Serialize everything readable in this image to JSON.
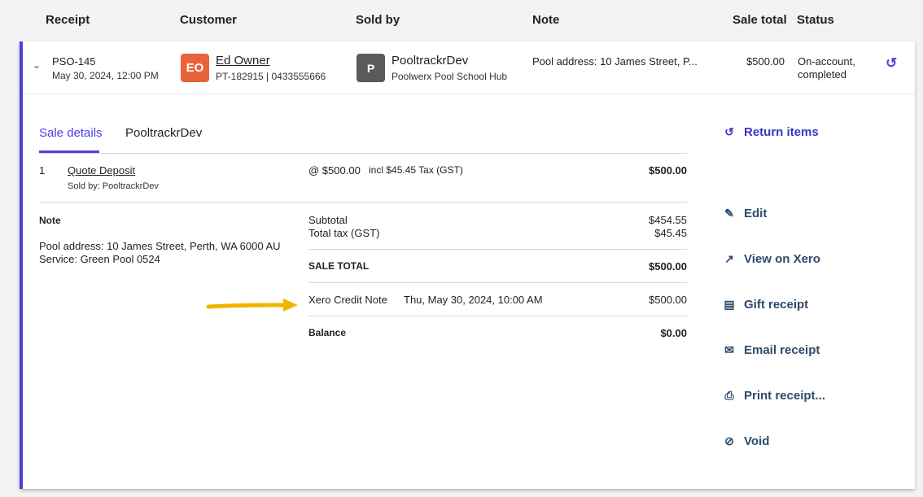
{
  "header": {
    "receipt": "Receipt",
    "customer": "Customer",
    "sold_by": "Sold by",
    "note": "Note",
    "sale_total": "Sale total",
    "status": "Status"
  },
  "row": {
    "receipt_id": "PSO-145",
    "receipt_date": "May 30, 2024, 12:00 PM",
    "customer_initials": "EO",
    "customer_name": "Ed Owner",
    "customer_sub": "PT-182915 | 0433555666",
    "sold_initial": "P",
    "sold_name": "PooltrackrDev",
    "sold_sub": "Poolwerx Pool School Hub",
    "note": "Pool address: 10 James Street, P...",
    "total": "$500.00",
    "status_line1": "On-account,",
    "status_line2": "completed"
  },
  "tabs": [
    {
      "label": "Sale details"
    },
    {
      "label": "PooltrackrDev"
    }
  ],
  "line_item": {
    "qty": "1",
    "name": "Quote Deposit",
    "sold_by": "Sold by: PooltrackrDev",
    "unit_price": "@ $500.00",
    "tax": "incl $45.45 Tax (GST)",
    "amount": "$500.00"
  },
  "note_section": {
    "title": "Note",
    "line1": "Pool address: 10 James Street, Perth, WA 6000 AU",
    "line2": "Service: Green Pool 0524"
  },
  "totals": {
    "subtotal_label": "Subtotal",
    "subtotal": "$454.55",
    "tax_label": "Total tax (GST)",
    "tax": "$45.45",
    "sale_total_label": "SALE TOTAL",
    "sale_total": "$500.00",
    "credit_label": "Xero Credit Note",
    "credit_date": "Thu, May 30, 2024, 10:00 AM",
    "credit_amount": "$500.00",
    "balance_label": "Balance",
    "balance": "$0.00"
  },
  "actions": {
    "return_items": "Return items",
    "edit": "Edit",
    "view_xero": "View on Xero",
    "gift_receipt": "Gift receipt",
    "email_receipt": "Email receipt",
    "print_receipt": "Print receipt...",
    "void": "Void"
  },
  "colors": {
    "accent": "#4b3fe0",
    "avatar_eo": "#e8623a",
    "avatar_p": "#5a5a5a",
    "arrow": "#f0b400",
    "action_text": "#2c4a6b"
  }
}
